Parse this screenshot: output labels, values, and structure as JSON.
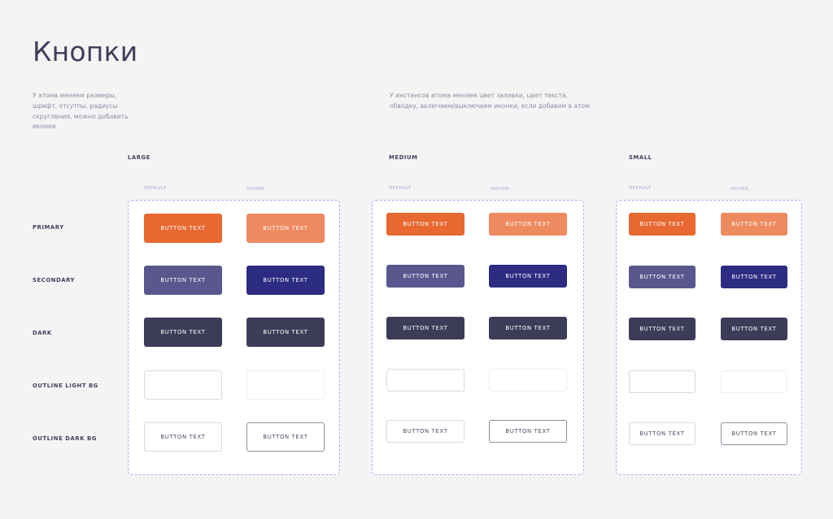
{
  "page": {
    "title": "Кнопки",
    "desc_atom": "У атома меняем размеры, шрифт, отсутпы, радиусы скругления, можно добавить иконки",
    "desc_instances": "У инстансов атома меняем цвет заливки, цвет текста, обводку, включаем/выключаем иконки, если добавим в атом"
  },
  "states": {
    "default": "DEFAULT",
    "hover": "HOVER"
  },
  "rows": [
    {
      "key": "primary",
      "label": "PRIMARY"
    },
    {
      "key": "secondary",
      "label": "SECONDARY"
    },
    {
      "key": "dark",
      "label": "DARK"
    },
    {
      "key": "outline-light",
      "label": "OUTLINE LIGHT BG"
    },
    {
      "key": "outline-dark",
      "label": "OUTLINE DARK BG"
    }
  ],
  "sizes": [
    {
      "key": "large",
      "label": "LARGE"
    },
    {
      "key": "medium",
      "label": "MEDIUM"
    },
    {
      "key": "small",
      "label": "SMALL"
    }
  ],
  "button_text": "BUTTON TEXT",
  "colors": {
    "primary_default": "#e86831",
    "primary_hover": "#ee8a5f",
    "secondary_default": "#5a578e",
    "secondary_hover": "#2c2c82",
    "dark": "#3d3c58",
    "panel_border": "#b3a8f7"
  }
}
